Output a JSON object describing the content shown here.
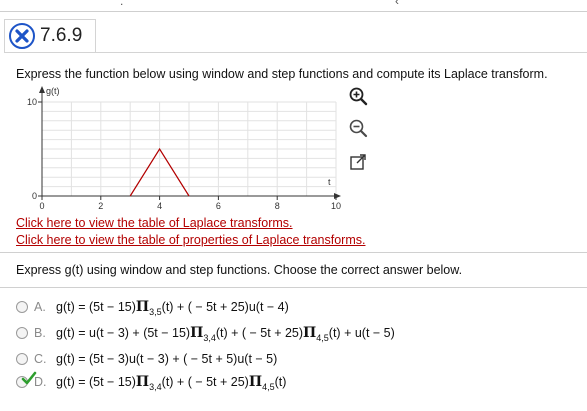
{
  "problem": {
    "id": "7.6.9",
    "status_icon": "x-circle-icon",
    "status_color": "#1d54c7"
  },
  "prompt_text": "Express the function below using window and step functions and compute its Laplace transform.",
  "graph": {
    "y_label": "g(t)",
    "x_label": "t",
    "y_ticks": [
      "10",
      "0"
    ],
    "x_ticks": [
      "0",
      "2",
      "4",
      "6",
      "8",
      "10"
    ],
    "line_color": "#b30000"
  },
  "chart_data": {
    "type": "line",
    "x": [
      3,
      4,
      5
    ],
    "y": [
      0,
      5,
      0
    ],
    "xlabel": "t",
    "ylabel": "g(t)",
    "xlim": [
      0,
      10
    ],
    "ylim": [
      0,
      10
    ],
    "grid": true
  },
  "tools": {
    "zoom_in": "zoom-in-icon",
    "zoom_out": "zoom-out-icon",
    "popout": "popout-icon"
  },
  "links": {
    "laplace_table": "Click here to view the table of Laplace transforms.",
    "properties_table": "Click here to view the table of properties of Laplace transforms."
  },
  "instruction": "Express g(t) using window and step functions. Choose the correct answer below.",
  "options": {
    "a": {
      "letter": "A.",
      "p1": "g(t) = (5t − 15)",
      "s1": "3,5",
      "p2": "(t) + ( − 5t + 25)u(t − 4)"
    },
    "b": {
      "letter": "B.",
      "p1": "g(t) = u(t − 3) + (5t − 15)",
      "s1": "3,4",
      "p2": "(t) + ( − 5t + 25)",
      "s2": "4,5",
      "p3": "(t) + u(t − 5)"
    },
    "c": {
      "letter": "C.",
      "p1": "g(t) = (5t − 3)u(t − 3) + ( − 5t + 5)u(t − 5)"
    },
    "d": {
      "letter": "D.",
      "p1": "g(t) = (5t − 15)",
      "s1": "3,4",
      "p2": "(t) + ( − 5t + 25)",
      "s2": "4,5",
      "p3": "(t)",
      "selected": true,
      "check_color": "#2e9e2e"
    }
  },
  "pi_symbol": "Π"
}
